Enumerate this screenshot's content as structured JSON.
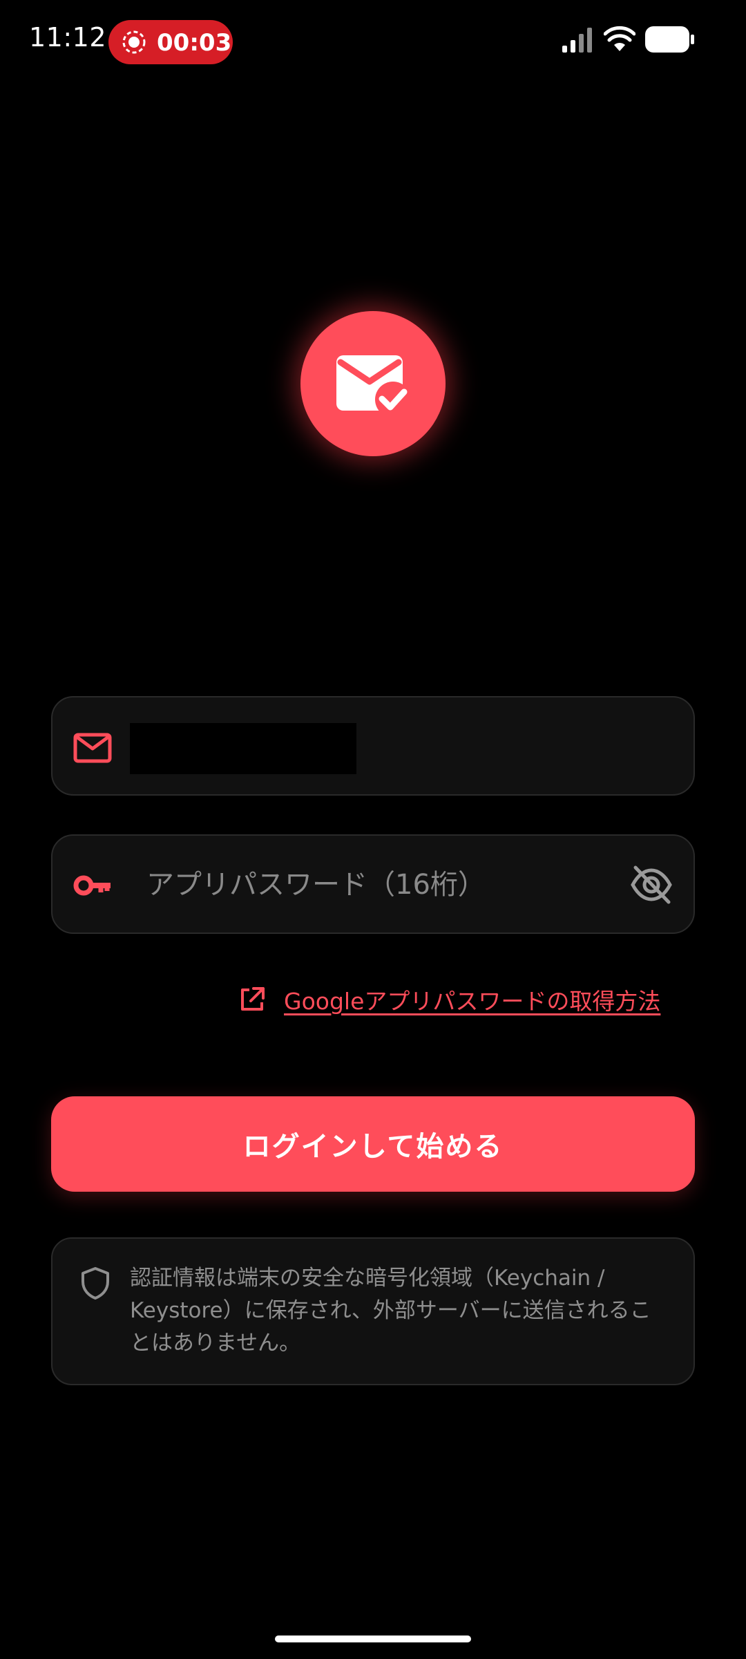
{
  "status_bar": {
    "time": "11:12",
    "recording_time": "00:03"
  },
  "login_form": {
    "email_value": "",
    "password_placeholder": "アプリパスワード（16桁）",
    "help_link_label": "Googleアプリパスワードの取得方法",
    "login_button_label": "ログインして始める",
    "security_note": "認証情報は端末の安全な暗号化領域（Keychain / Keystore）に保存され、外部サーバーに送信されることはありません。"
  },
  "icons": {
    "logo": "mail-check-icon",
    "email": "mail-icon",
    "password": "key-icon",
    "visibility": "eye-off-icon",
    "help": "external-link-icon",
    "security": "shield-icon"
  },
  "colors": {
    "accent": "#ff4d5a",
    "background": "#000000",
    "field_background": "#111111",
    "field_border": "#2a2a2a",
    "muted_text": "#8f8f8f",
    "recording": "#d61e26"
  }
}
